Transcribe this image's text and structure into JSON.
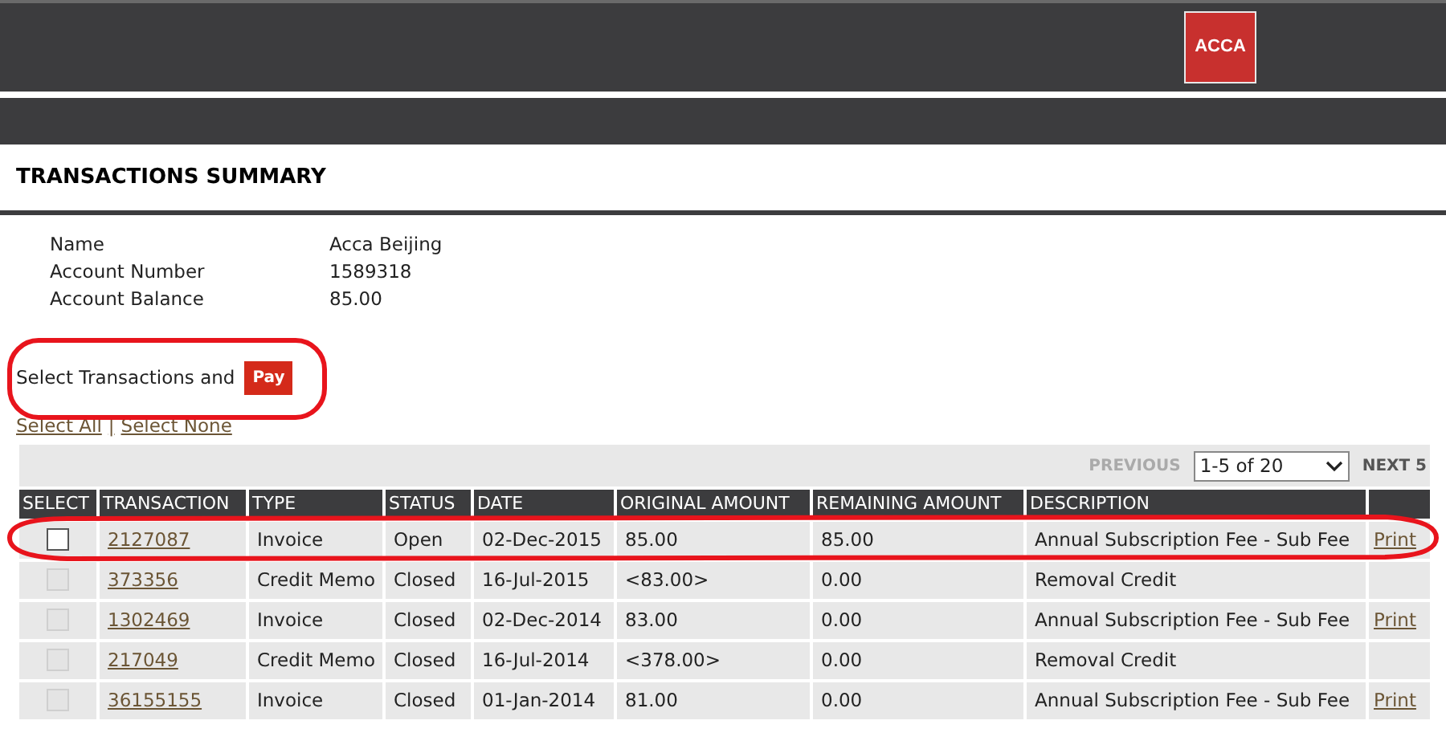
{
  "header": {
    "logo": "ACCA"
  },
  "page_title": "TRANSACTIONS SUMMARY",
  "account": [
    {
      "label": "Name",
      "value": "Acca Beijing"
    },
    {
      "label": "Account Number",
      "value": "1589318"
    },
    {
      "label": "Account Balance",
      "value": "85.00"
    }
  ],
  "pay_prompt": {
    "text": "Select Transactions and",
    "button": "Pay"
  },
  "select_links": {
    "all": "Select All",
    "separator": "|",
    "none": "Select None"
  },
  "pager": {
    "previous": "PREVIOUS",
    "previous_disabled": true,
    "range": "1-5 of 20",
    "next": "NEXT 5"
  },
  "table": {
    "columns": [
      "SELECT",
      "TRANSACTION",
      "TYPE",
      "STATUS",
      "DATE",
      "ORIGINAL AMOUNT",
      "REMAINING AMOUNT",
      "DESCRIPTION"
    ],
    "rows": [
      {
        "checked": false,
        "disabled": false,
        "transaction": "2127087",
        "type": "Invoice",
        "status": "Open",
        "date": "02-Dec-2015",
        "original": "85.00",
        "remaining": "85.00",
        "description": "Annual Subscription Fee - Sub Fee",
        "print": "Print"
      },
      {
        "checked": false,
        "disabled": true,
        "transaction": "373356",
        "type": "Credit Memo",
        "status": "Closed",
        "date": "16-Jul-2015",
        "original": "<83.00>",
        "remaining": "0.00",
        "description": "Removal Credit"
      },
      {
        "checked": false,
        "disabled": true,
        "transaction": "1302469",
        "type": "Invoice",
        "status": "Closed",
        "date": "02-Dec-2014",
        "original": "83.00",
        "remaining": "0.00",
        "description": "Annual Subscription Fee - Sub Fee",
        "print": "Print"
      },
      {
        "checked": false,
        "disabled": true,
        "transaction": "217049",
        "type": "Credit Memo",
        "status": "Closed",
        "date": "16-Jul-2014",
        "original": "<378.00>",
        "remaining": "0.00",
        "description": "Removal Credit"
      },
      {
        "checked": false,
        "disabled": true,
        "transaction": "36155155",
        "type": "Invoice",
        "status": "Closed",
        "date": "01-Jan-2014",
        "original": "81.00",
        "remaining": "0.00",
        "description": "Annual Subscription Fee - Sub Fee",
        "print": "Print"
      }
    ]
  }
}
